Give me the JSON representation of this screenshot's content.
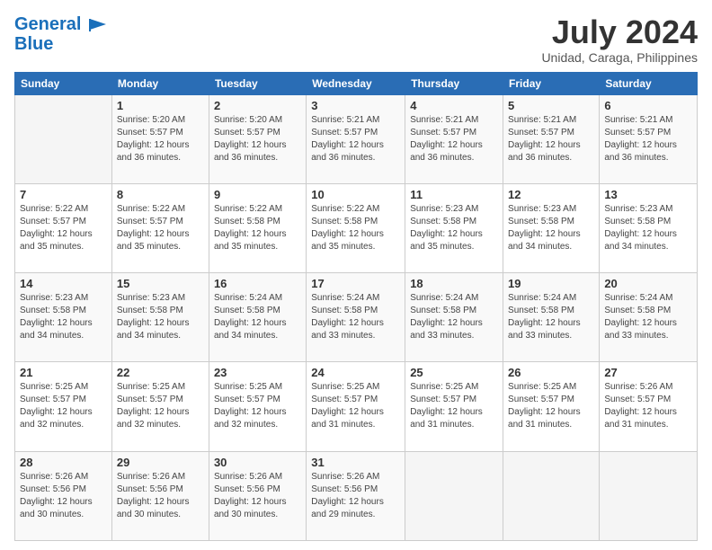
{
  "header": {
    "logo_line1": "General",
    "logo_line2": "Blue",
    "month_year": "July 2024",
    "location": "Unidad, Caraga, Philippines"
  },
  "weekdays": [
    "Sunday",
    "Monday",
    "Tuesday",
    "Wednesday",
    "Thursday",
    "Friday",
    "Saturday"
  ],
  "weeks": [
    [
      {
        "day": "",
        "info": ""
      },
      {
        "day": "1",
        "info": "Sunrise: 5:20 AM\nSunset: 5:57 PM\nDaylight: 12 hours\nand 36 minutes."
      },
      {
        "day": "2",
        "info": "Sunrise: 5:20 AM\nSunset: 5:57 PM\nDaylight: 12 hours\nand 36 minutes."
      },
      {
        "day": "3",
        "info": "Sunrise: 5:21 AM\nSunset: 5:57 PM\nDaylight: 12 hours\nand 36 minutes."
      },
      {
        "day": "4",
        "info": "Sunrise: 5:21 AM\nSunset: 5:57 PM\nDaylight: 12 hours\nand 36 minutes."
      },
      {
        "day": "5",
        "info": "Sunrise: 5:21 AM\nSunset: 5:57 PM\nDaylight: 12 hours\nand 36 minutes."
      },
      {
        "day": "6",
        "info": "Sunrise: 5:21 AM\nSunset: 5:57 PM\nDaylight: 12 hours\nand 36 minutes."
      }
    ],
    [
      {
        "day": "7",
        "info": "Sunrise: 5:22 AM\nSunset: 5:57 PM\nDaylight: 12 hours\nand 35 minutes."
      },
      {
        "day": "8",
        "info": "Sunrise: 5:22 AM\nSunset: 5:57 PM\nDaylight: 12 hours\nand 35 minutes."
      },
      {
        "day": "9",
        "info": "Sunrise: 5:22 AM\nSunset: 5:58 PM\nDaylight: 12 hours\nand 35 minutes."
      },
      {
        "day": "10",
        "info": "Sunrise: 5:22 AM\nSunset: 5:58 PM\nDaylight: 12 hours\nand 35 minutes."
      },
      {
        "day": "11",
        "info": "Sunrise: 5:23 AM\nSunset: 5:58 PM\nDaylight: 12 hours\nand 35 minutes."
      },
      {
        "day": "12",
        "info": "Sunrise: 5:23 AM\nSunset: 5:58 PM\nDaylight: 12 hours\nand 34 minutes."
      },
      {
        "day": "13",
        "info": "Sunrise: 5:23 AM\nSunset: 5:58 PM\nDaylight: 12 hours\nand 34 minutes."
      }
    ],
    [
      {
        "day": "14",
        "info": "Sunrise: 5:23 AM\nSunset: 5:58 PM\nDaylight: 12 hours\nand 34 minutes."
      },
      {
        "day": "15",
        "info": "Sunrise: 5:23 AM\nSunset: 5:58 PM\nDaylight: 12 hours\nand 34 minutes."
      },
      {
        "day": "16",
        "info": "Sunrise: 5:24 AM\nSunset: 5:58 PM\nDaylight: 12 hours\nand 34 minutes."
      },
      {
        "day": "17",
        "info": "Sunrise: 5:24 AM\nSunset: 5:58 PM\nDaylight: 12 hours\nand 33 minutes."
      },
      {
        "day": "18",
        "info": "Sunrise: 5:24 AM\nSunset: 5:58 PM\nDaylight: 12 hours\nand 33 minutes."
      },
      {
        "day": "19",
        "info": "Sunrise: 5:24 AM\nSunset: 5:58 PM\nDaylight: 12 hours\nand 33 minutes."
      },
      {
        "day": "20",
        "info": "Sunrise: 5:24 AM\nSunset: 5:58 PM\nDaylight: 12 hours\nand 33 minutes."
      }
    ],
    [
      {
        "day": "21",
        "info": "Sunrise: 5:25 AM\nSunset: 5:57 PM\nDaylight: 12 hours\nand 32 minutes."
      },
      {
        "day": "22",
        "info": "Sunrise: 5:25 AM\nSunset: 5:57 PM\nDaylight: 12 hours\nand 32 minutes."
      },
      {
        "day": "23",
        "info": "Sunrise: 5:25 AM\nSunset: 5:57 PM\nDaylight: 12 hours\nand 32 minutes."
      },
      {
        "day": "24",
        "info": "Sunrise: 5:25 AM\nSunset: 5:57 PM\nDaylight: 12 hours\nand 31 minutes."
      },
      {
        "day": "25",
        "info": "Sunrise: 5:25 AM\nSunset: 5:57 PM\nDaylight: 12 hours\nand 31 minutes."
      },
      {
        "day": "26",
        "info": "Sunrise: 5:25 AM\nSunset: 5:57 PM\nDaylight: 12 hours\nand 31 minutes."
      },
      {
        "day": "27",
        "info": "Sunrise: 5:26 AM\nSunset: 5:57 PM\nDaylight: 12 hours\nand 31 minutes."
      }
    ],
    [
      {
        "day": "28",
        "info": "Sunrise: 5:26 AM\nSunset: 5:56 PM\nDaylight: 12 hours\nand 30 minutes."
      },
      {
        "day": "29",
        "info": "Sunrise: 5:26 AM\nSunset: 5:56 PM\nDaylight: 12 hours\nand 30 minutes."
      },
      {
        "day": "30",
        "info": "Sunrise: 5:26 AM\nSunset: 5:56 PM\nDaylight: 12 hours\nand 30 minutes."
      },
      {
        "day": "31",
        "info": "Sunrise: 5:26 AM\nSunset: 5:56 PM\nDaylight: 12 hours\nand 29 minutes."
      },
      {
        "day": "",
        "info": ""
      },
      {
        "day": "",
        "info": ""
      },
      {
        "day": "",
        "info": ""
      }
    ]
  ]
}
